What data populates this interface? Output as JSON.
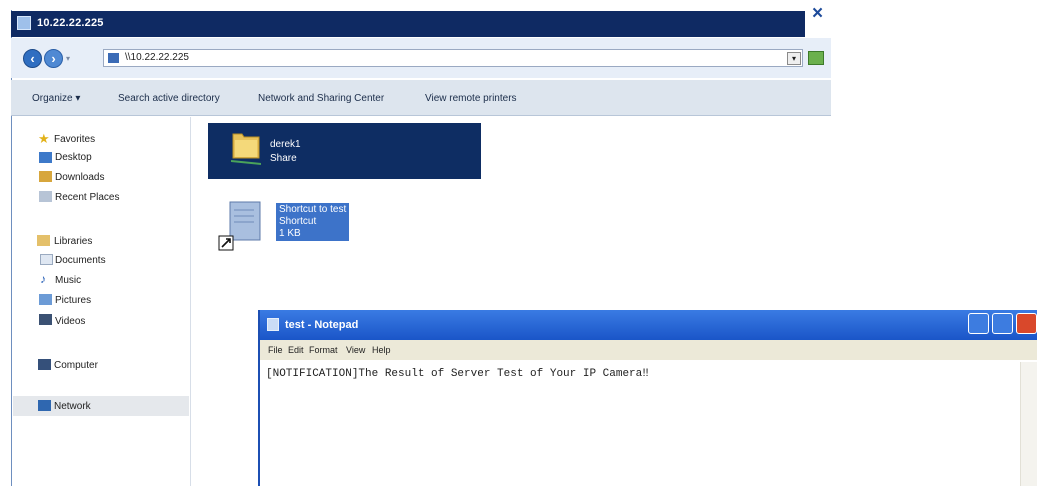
{
  "explorer": {
    "title": "10.22.22.225",
    "address": "\\\\10.22.22.225",
    "toolbar": [
      "Organize ▾",
      "Search active directory",
      "Network and Sharing Center",
      "View remote printers"
    ],
    "nav": {
      "favorites": "Favorites",
      "desktop": "Desktop",
      "downloads": "Downloads",
      "recent": "Recent Places",
      "libraries": "Libraries",
      "documents": "Documents",
      "music": "Music",
      "pictures": "Pictures",
      "videos": "Videos",
      "computer": "Computer",
      "network": "Network"
    },
    "items": {
      "share_name": "derek1",
      "share_type": "Share",
      "shortcut_name": "Shortcut to test",
      "shortcut_type": "Shortcut",
      "shortcut_size": "1 KB"
    }
  },
  "notepad": {
    "title": "test - Notepad",
    "menu": [
      "File",
      "Edit",
      "Format",
      "View",
      "Help"
    ],
    "content": "[NOTIFICATION]The Result of Server Test of Your IP Camera‼"
  },
  "colors": {
    "explorer_title_bg": "#0f2a63",
    "selection_bg": "#0e2d63",
    "notepad_title_bg": "#1a55c8"
  }
}
